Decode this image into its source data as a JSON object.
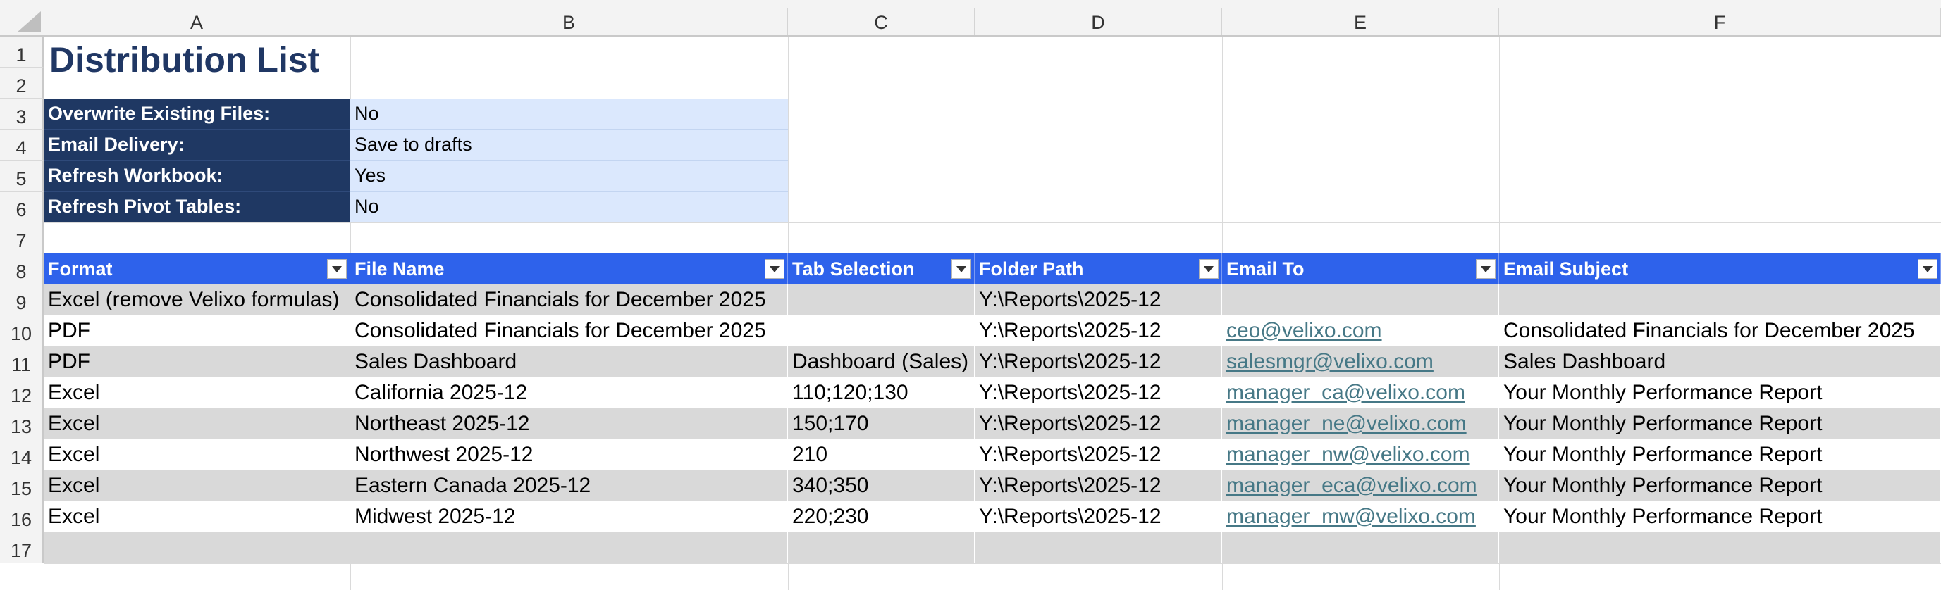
{
  "columns": [
    "A",
    "B",
    "C",
    "D",
    "E",
    "F"
  ],
  "rows": [
    "1",
    "2",
    "3",
    "4",
    "5",
    "6",
    "7",
    "8",
    "9",
    "10",
    "11",
    "12",
    "13",
    "14",
    "15",
    "16",
    "17"
  ],
  "title": "Distribution List",
  "settings": [
    {
      "label": "Overwrite Existing Files:",
      "value": "No"
    },
    {
      "label": "Email Delivery:",
      "value": "Save to drafts"
    },
    {
      "label": "Refresh Workbook:",
      "value": "Yes"
    },
    {
      "label": "Refresh Pivot Tables:",
      "value": "No"
    }
  ],
  "table": {
    "headers": [
      "Format",
      "File Name",
      "Tab Selection",
      "Folder Path",
      "Email To",
      "Email Subject"
    ],
    "rows": [
      [
        "Excel (remove Velixo formulas)",
        "Consolidated Financials for December 2025",
        "",
        "Y:\\Reports\\2025-12",
        "",
        ""
      ],
      [
        "PDF",
        "Consolidated Financials for December 2025",
        "",
        "Y:\\Reports\\2025-12",
        "ceo@velixo.com",
        "Consolidated Financials for December 2025"
      ],
      [
        "PDF",
        "Sales Dashboard",
        "Dashboard (Sales)",
        "Y:\\Reports\\2025-12",
        "salesmgr@velixo.com",
        "Sales Dashboard"
      ],
      [
        "Excel",
        "California 2025-12",
        "110;120;130",
        "Y:\\Reports\\2025-12",
        "manager_ca@velixo.com",
        "Your Monthly Performance Report"
      ],
      [
        "Excel",
        "Northeast 2025-12",
        "150;170",
        "Y:\\Reports\\2025-12",
        "manager_ne@velixo.com",
        "Your Monthly Performance Report"
      ],
      [
        "Excel",
        "Northwest 2025-12",
        "210",
        "Y:\\Reports\\2025-12",
        "manager_nw@velixo.com",
        "Your Monthly Performance Report"
      ],
      [
        "Excel",
        "Eastern Canada 2025-12",
        "340;350",
        "Y:\\Reports\\2025-12",
        "manager_eca@velixo.com",
        "Your Monthly Performance Report"
      ],
      [
        "Excel",
        "Midwest 2025-12",
        "220;230",
        "Y:\\Reports\\2025-12",
        "manager_mw@velixo.com",
        "Your Monthly Performance Report"
      ],
      [
        "",
        "",
        "",
        "",
        "",
        ""
      ]
    ]
  },
  "colors": {
    "title": "#203764",
    "settings_label_bg": "#1f3863",
    "settings_value_bg": "#dbe8fd",
    "header_bg": "#2e62eb",
    "band_gray": "#d9d9d9",
    "link": "#467886"
  },
  "icons": {
    "select_all": "select-all-triangle-icon",
    "filter": "filter-dropdown-icon"
  }
}
